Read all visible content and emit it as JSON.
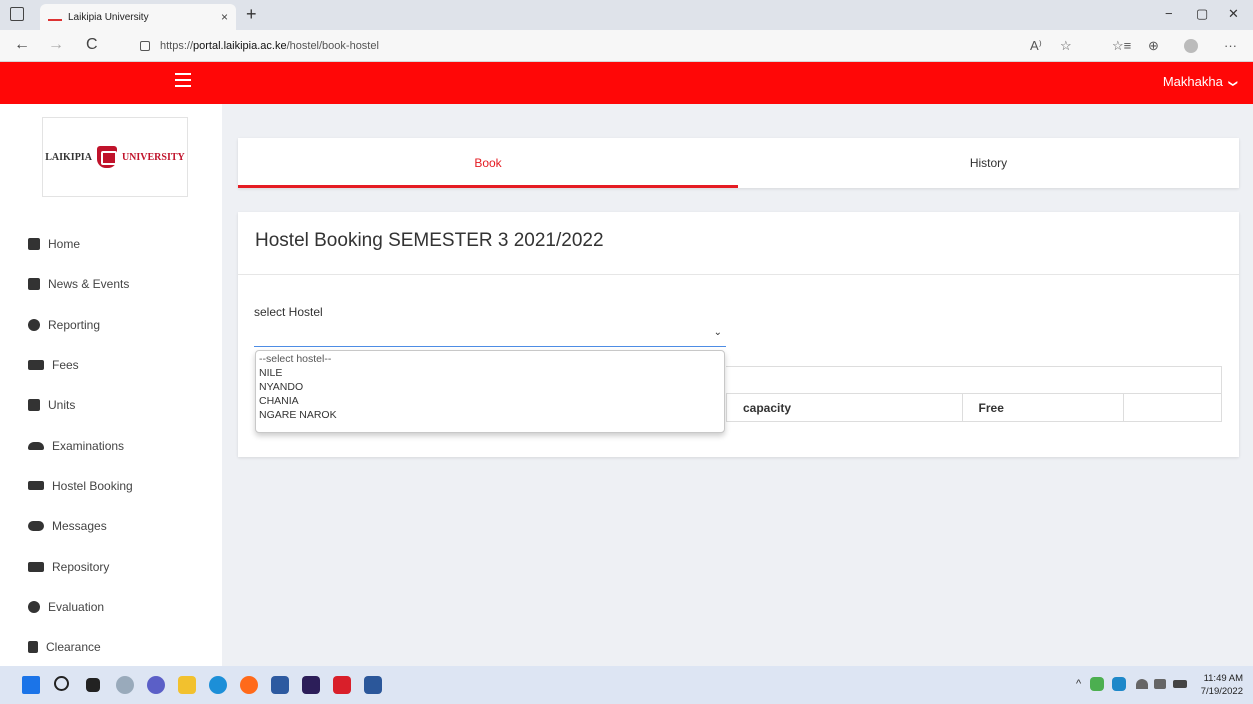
{
  "browser": {
    "tab_title": "Laikipia University",
    "tab_close": "×",
    "new_tab": "+",
    "url_prefix": "https://",
    "url_domain": "portal.laikipia.ac.ke",
    "url_path": "/hostel/book-hostel",
    "nav_back": "←",
    "nav_forward": "→",
    "nav_refresh": "C",
    "read_aloud": "A⁾",
    "favorites_add": "☆",
    "favorites": "☆≡",
    "collections": "⊕",
    "menu": "···",
    "minimize": "−",
    "maximize": "▢",
    "close": "✕"
  },
  "header": {
    "user_name": "Makhakha",
    "user_chevron": "❯"
  },
  "logo": {
    "left_text": "LAIKIPIA",
    "right_text": "UNIVERSITY"
  },
  "sidebar": {
    "items": [
      {
        "label": "Home",
        "icon": "home-icon"
      },
      {
        "label": "News & Events",
        "icon": "calendar-icon"
      },
      {
        "label": "Reporting",
        "icon": "clock-icon"
      },
      {
        "label": "Fees",
        "icon": "money-icon"
      },
      {
        "label": "Units",
        "icon": "book-icon"
      },
      {
        "label": "Examinations",
        "icon": "graduation-cap-icon"
      },
      {
        "label": "Hostel Booking",
        "icon": "bed-icon"
      },
      {
        "label": "Messages",
        "icon": "comments-icon"
      },
      {
        "label": "Repository",
        "icon": "folder-icon"
      },
      {
        "label": "Evaluation",
        "icon": "clock-icon"
      },
      {
        "label": "Clearance",
        "icon": "file-icon"
      }
    ]
  },
  "tabs": {
    "book": "Book",
    "history": "History"
  },
  "panel": {
    "title": "Hostel Booking SEMESTER 3 2021/2022",
    "select_label": "select Hostel",
    "select_chevron": "⌄",
    "options": [
      "--select hostel--",
      "NILE",
      "NYANDO",
      "CHANIA",
      "NGARE NAROK"
    ]
  },
  "table": {
    "headers": [
      "capacity",
      "Free",
      ""
    ]
  },
  "taskbar": {
    "time": "11:49 AM",
    "date": "7/19/2022"
  },
  "colors": {
    "brand_red": "#ff0707",
    "active_tab": "#e51c23",
    "focus_blue": "#4d8ce4"
  }
}
